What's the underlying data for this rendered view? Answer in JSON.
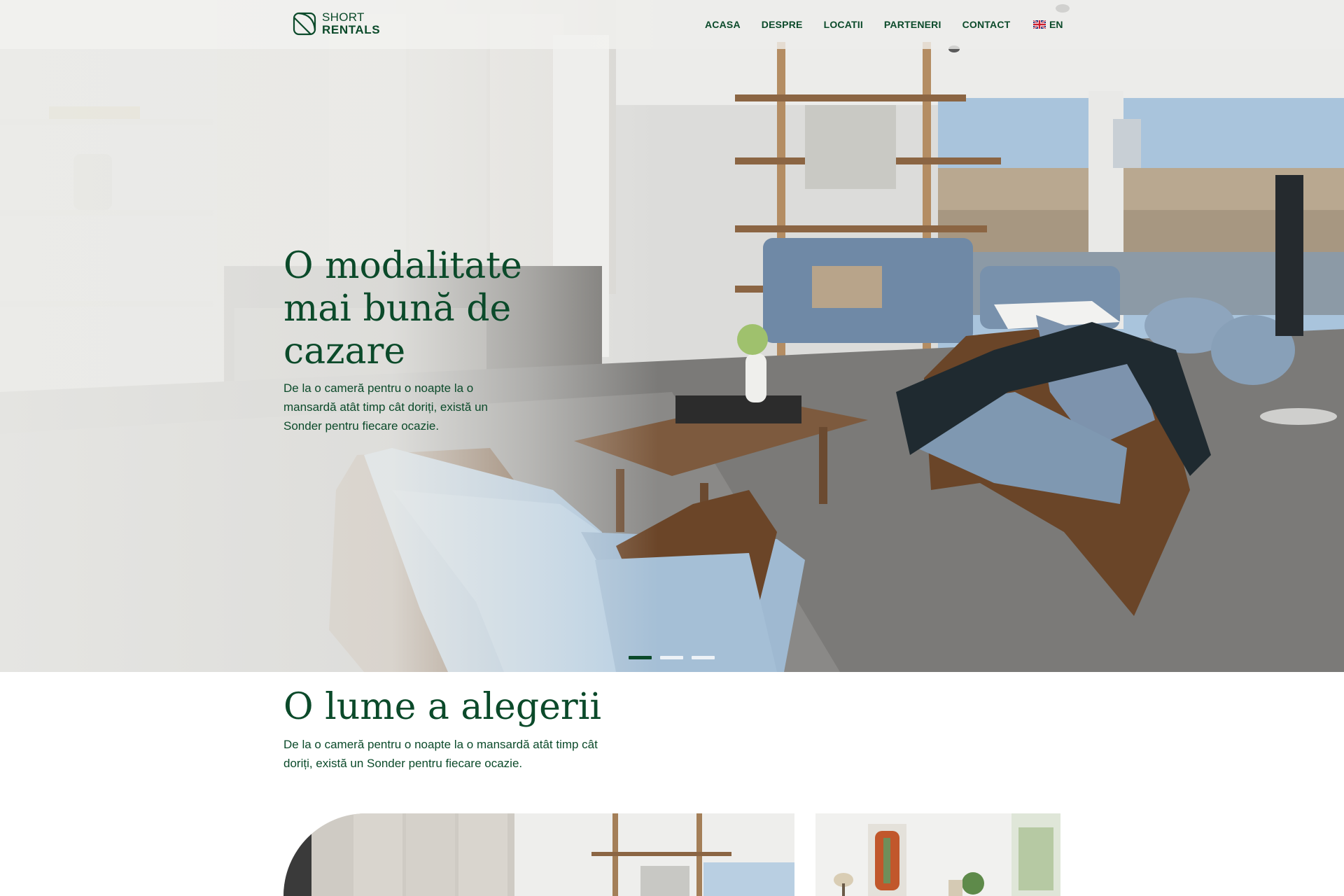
{
  "header": {
    "logo": {
      "line1": "SHORT",
      "line2": "RENTALS"
    },
    "nav": [
      "ACASA",
      "DESPRE",
      "LOCATII",
      "PARTENERI",
      "CONTACT"
    ],
    "language": {
      "label": "EN",
      "flag_icon": "uk-flag-icon"
    }
  },
  "hero": {
    "title": "O modalitate mai bună de cazare",
    "subtitle": "De la o cameră pentru o noapte la o mansardă atât timp cât doriți, există un Sonder pentru fiecare ocazie.",
    "slides": 3,
    "active_slide": 1
  },
  "section": {
    "title": "O lume a alegerii",
    "subtitle": "De la o cameră pentru o noapte la o mansardă atât timp cât doriți, există un Sonder pentru fiecare ocazie."
  },
  "colors": {
    "brand_green": "#0b4a2a",
    "header_bg": "#f2f2f0",
    "accent_blue": "#8fa9c4"
  }
}
